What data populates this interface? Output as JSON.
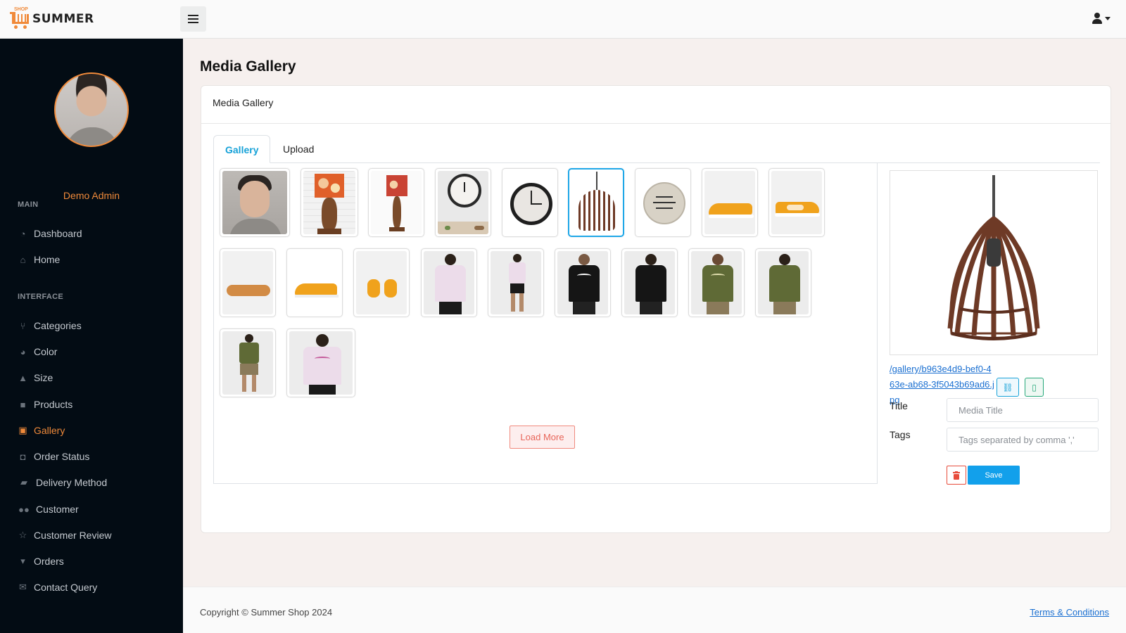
{
  "brand": {
    "logo_small": "SHOP",
    "logo_text": "SUMMER"
  },
  "header": {
    "menu_icon": "hamburger-icon",
    "user_icon": "user-icon"
  },
  "sidebar": {
    "admin_name": "Demo Admin",
    "sections": [
      {
        "label": "MAIN",
        "items": [
          {
            "label": "Dashboard",
            "icon": "dashboard-icon"
          },
          {
            "label": "Home",
            "icon": "home-icon"
          }
        ]
      },
      {
        "label": "INTERFACE",
        "items": [
          {
            "label": "Categories",
            "icon": "categories-icon"
          },
          {
            "label": "Color",
            "icon": "palette-icon"
          },
          {
            "label": "Size",
            "icon": "bell-icon"
          },
          {
            "label": "Products",
            "icon": "box-icon"
          },
          {
            "label": "Gallery",
            "icon": "images-icon",
            "active": true
          },
          {
            "label": "Order Status",
            "icon": "bag-icon"
          },
          {
            "label": "Delivery Method",
            "icon": "truck-icon"
          },
          {
            "label": "Customer",
            "icon": "users-icon"
          },
          {
            "label": "Customer Review",
            "icon": "star-icon"
          },
          {
            "label": "Orders",
            "icon": "cart-icon"
          },
          {
            "label": "Contact Query",
            "icon": "message-icon"
          }
        ]
      }
    ]
  },
  "page": {
    "title": "Media Gallery"
  },
  "card": {
    "header": "Media Gallery",
    "tabs": [
      "Gallery",
      "Upload"
    ],
    "active_tab": "Gallery",
    "load_more": "Load More"
  },
  "gallery": {
    "selected_index": 5,
    "items": [
      "man-portrait",
      "lamp-orange-floral",
      "lamp-red-floral",
      "wall-clock-room",
      "wall-clock-black",
      "wooden-pendant-lamp",
      "wall-clock-beige",
      "sneaker-orange-side",
      "sneaker-orange-side-2",
      "sneaker-sole",
      "sneaker-orange-angle",
      "sneaker-orange-pair",
      "tshirt-pink-back",
      "tshirt-pink-model",
      "tshirt-black-front",
      "tshirt-black-back",
      "tshirt-olive-front",
      "tshirt-olive-back",
      "tshirt-olive-model",
      "tshirt-pink-front"
    ]
  },
  "details": {
    "file_path": "/gallery/b963e4d9-bef0-463e-ab68-3f5043b69ad6.jpg",
    "copy_icon": "link-icon",
    "clipboard_icon": "clipboard-icon",
    "title_label": "Title",
    "title_placeholder": "Media Title",
    "tags_label": "Tags",
    "tags_placeholder": "Tags separated by comma ','",
    "delete_icon": "trash-icon",
    "save_label": "Save"
  },
  "footer": {
    "copyright": "Copyright © Summer Shop 2024",
    "terms": "Terms & Conditions"
  },
  "colors": {
    "accent": "#f08a3a",
    "primary": "#12a0eb",
    "danger": "#e74c3c",
    "sidebar": "#030c14"
  }
}
